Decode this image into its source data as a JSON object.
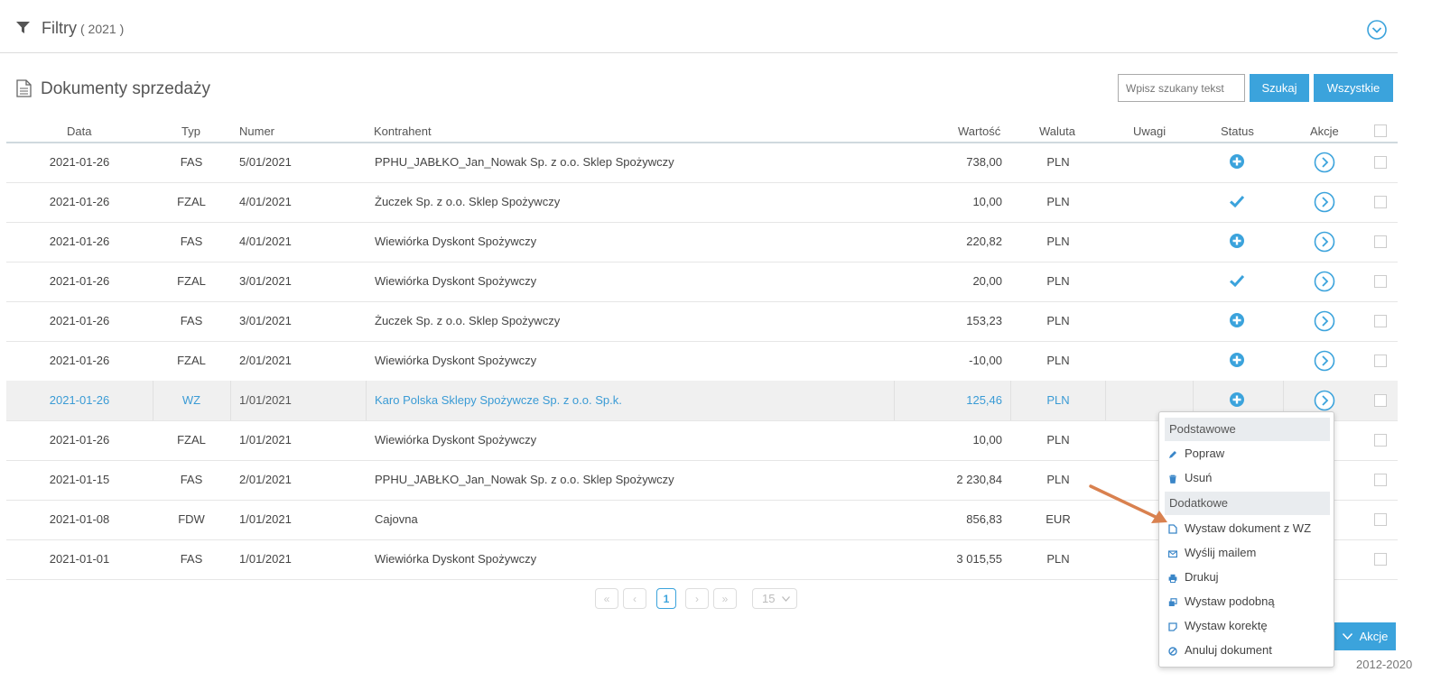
{
  "filters": {
    "title": "Filtry",
    "year": "( 2021 )"
  },
  "section": {
    "title": "Dokumenty sprzedaży"
  },
  "search": {
    "placeholder": "Wpisz szukany tekst",
    "search_label": "Szukaj",
    "all_label": "Wszystkie"
  },
  "columns": {
    "date": "Data",
    "type": "Typ",
    "number": "Numer",
    "contractor": "Kontrahent",
    "value": "Wartość",
    "currency": "Waluta",
    "notes": "Uwagi",
    "status": "Status",
    "actions": "Akcje"
  },
  "rows": [
    {
      "date": "2021-01-26",
      "type": "FAS",
      "number": "5/01/2021",
      "contractor": "PPHU_JABŁKO_Jan_Nowak Sp. z o.o. Sklep Spożywczy",
      "value": "738,00",
      "currency": "PLN",
      "status": "plus-circle"
    },
    {
      "date": "2021-01-26",
      "type": "FZAL",
      "number": "4/01/2021",
      "contractor": "Żuczek Sp. z o.o. Sklep Spożywczy",
      "value": "10,00",
      "currency": "PLN",
      "status": "check"
    },
    {
      "date": "2021-01-26",
      "type": "FAS",
      "number": "4/01/2021",
      "contractor": "Wiewiórka Dyskont Spożywczy",
      "value": "220,82",
      "currency": "PLN",
      "status": "plus-circle"
    },
    {
      "date": "2021-01-26",
      "type": "FZAL",
      "number": "3/01/2021",
      "contractor": "Wiewiórka Dyskont Spożywczy",
      "value": "20,00",
      "currency": "PLN",
      "status": "check"
    },
    {
      "date": "2021-01-26",
      "type": "FAS",
      "number": "3/01/2021",
      "contractor": "Żuczek Sp. z o.o. Sklep Spożywczy",
      "value": "153,23",
      "currency": "PLN",
      "status": "plus-circle"
    },
    {
      "date": "2021-01-26",
      "type": "FZAL",
      "number": "2/01/2021",
      "contractor": "Wiewiórka Dyskont Spożywczy",
      "value": "-10,00",
      "currency": "PLN",
      "status": "plus-circle"
    },
    {
      "date": "2021-01-26",
      "type": "WZ",
      "number": "1/01/2021",
      "contractor": "Karo Polska Sklepy Spożywcze Sp. z o.o. Sp.k.",
      "value": "125,46",
      "currency": "PLN",
      "status": "plus-circle"
    },
    {
      "date": "2021-01-26",
      "type": "FZAL",
      "number": "1/01/2021",
      "contractor": "Wiewiórka Dyskont Spożywczy",
      "value": "10,00",
      "currency": "PLN",
      "status": ""
    },
    {
      "date": "2021-01-15",
      "type": "FAS",
      "number": "2/01/2021",
      "contractor": "PPHU_JABŁKO_Jan_Nowak Sp. z o.o. Sklep Spożywczy",
      "value": "2 230,84",
      "currency": "PLN",
      "status": ""
    },
    {
      "date": "2021-01-08",
      "type": "FDW",
      "number": "1/01/2021",
      "contractor": "Cajovna",
      "value": "856,83",
      "currency": "EUR",
      "status": ""
    },
    {
      "date": "2021-01-01",
      "type": "FAS",
      "number": "1/01/2021",
      "contractor": "Wiewiórka Dyskont Spożywczy",
      "value": "3 015,55",
      "currency": "PLN",
      "status": ""
    }
  ],
  "pagination": {
    "current": "1",
    "page_size": "15"
  },
  "actions_button": {
    "label": "Akcje"
  },
  "footer": {
    "text": "2012-2020"
  },
  "context_menu": {
    "groups": [
      {
        "title": "Podstawowe",
        "items": [
          {
            "label": "Popraw",
            "icon": "pencil-icon"
          },
          {
            "label": "Usuń",
            "icon": "trash-icon"
          }
        ]
      },
      {
        "title": "Dodatkowe",
        "items": [
          {
            "label": "Wystaw dokument z WZ",
            "icon": "document-icon"
          },
          {
            "label": "Wyślij mailem",
            "icon": "envelope-icon"
          },
          {
            "label": "Drukuj",
            "icon": "printer-icon"
          },
          {
            "label": "Wystaw podobną",
            "icon": "copy-icon"
          },
          {
            "label": "Wystaw korektę",
            "icon": "note-icon"
          },
          {
            "label": "Anuluj dokument",
            "icon": "ban-icon"
          }
        ]
      }
    ]
  },
  "colors": {
    "accent": "#3ba3dc",
    "arrow": "#d9814f",
    "highlight_row": "#f0f0f0"
  }
}
